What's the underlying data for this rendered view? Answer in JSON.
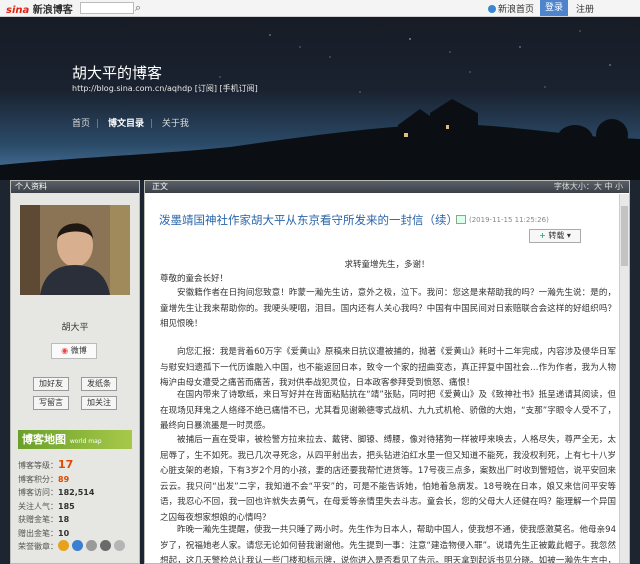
{
  "topbar": {
    "logo_brand": "sina",
    "logo_text": "新浪博客",
    "new_version": "新浪首页",
    "login": "登录",
    "register": "注册"
  },
  "header": {
    "title": "胡大平的博客",
    "url_line": "http://blog.sina.com.cn/aqhdp  [订阅]  [手机订阅]",
    "nav": [
      "首页",
      "博文目录",
      "关于我"
    ]
  },
  "profile": {
    "section_title": "个人资料",
    "name": "胡大平",
    "weibo_label": "微博",
    "buttons": [
      "加好友",
      "发纸条",
      "写留言",
      "加关注"
    ],
    "blogmap_label": "博客地图",
    "blogmap_sub": "world map",
    "stats": [
      {
        "label": "博客等级：",
        "value": "17"
      },
      {
        "label": "博客积分：",
        "value": "89"
      },
      {
        "label": "博客访问：",
        "value": "182,514"
      },
      {
        "label": "关注人气：",
        "value": "185"
      },
      {
        "label": "获赠金笔：",
        "value": "18"
      },
      {
        "label": "赠出金笔：",
        "value": "10"
      },
      {
        "label": "荣誉徽章：",
        "value": ""
      }
    ],
    "medal_colors": [
      "#e7a21b",
      "#3b7fd0",
      "#9a9a9a",
      "#6a6a6a",
      "#b5b5b5"
    ]
  },
  "main": {
    "section_title": "正文",
    "fontsize_label": "字体大小：大 中 小",
    "post_title": "泼墨靖国神社作家胡大平从东京看守所发来的一封信（续）",
    "post_date": "(2019-11-15 11:25:26)",
    "repost_label": "转载",
    "greeting": "求转童增先生，多谢！",
    "salute": "尊敬的童会长好！",
    "paragraphs": [
      "安徽籍作者在日拘间您致意！昨蒙一瀚先生访，意外之极，泣下。我问：您这是来帮助我的吗？一瀚先生说：是的，童增先生让我来帮助你的。我哽头哽咽，泪目。国内还有人关心我吗？中国有中国民间对日索赔联合会这样的好组织吗？相见恨晚！",
      "",
      "向您汇报：我是背着60万字《爱黄山》原稿来日抗议遭被捕的，抛著《爱黄山》耗时十二年完成，内容涉及侵华日军与慰安妇遗孤下一代历谁融入中国，也不能返回日本，致令一个家的扭曲变态，真正抨复中国社会…作为作者，我为人物梅沪由母女遭受之痛苦而痛苦，我对供奉战犯灵位，日本政客参拜受到愤怒、痛恨！",
      "在国内带来了诗歌纸，来日写好并在背面粘贴抗在“靖”张贴，同时把《爱黄山》及《致神社书》抵呈递请其阅读，但在现场见拜鬼之人络绎不绝已痛惜不已，尤其看见谢赖德零式战机、九九式机枪、骄傲的大炮，“支那”字眼令人受不了，最终向日暴流墨是一时灵感。",
      "被捕后一直在受审，被检警方拉来拉去、戴铐、脚镣、缚腰，像对待猪狗一样被呼来唤去，人格尽失，尊严全无，太屈辱了，生不如死。我已几次寻死念，从四平射出去，把头钻进泊红水里一但又知道不能死，我没权利死，上有七十八岁心脏支架的老娘，下有3岁2个月的小孩，妻的店还要我帮忙进货等。17号夜三点多，案数出厂时收到警短信，说平安回来云云。我只问“出发”二字，我知道不会“平安”的，可是不能告诉她，怕她着急病发。18号晚在日本，娘又来信问平安等语，我忍心不回，我一回也许就失去勇气，在母爱等亲情里失去斗志。童会长，您的父母大人还健在吗？能理解一个异国之囚每夜想家想娘的心情吗？",
      "昨晚一瀚先生提醒，使我一共只睡了两小时。先生作为日本人，帮助中国人，使我想不通，使我感激莫名。他母亲94岁了，祝福她老人家。请您无论如何替我谢谢他。先生提到一事：注意“建造物侵入罪”。说靖先生正被戴此帽子。我忽然想起，这几天警检总让我认一些门楼和标示牌，说你进入是否看见了告示。明天拿到起诉书见分晓。如被一瀚先生言中，那就说明日本人太阴谋狡诈了，他们欺负一个中国人的善良，与当年的"
    ]
  }
}
